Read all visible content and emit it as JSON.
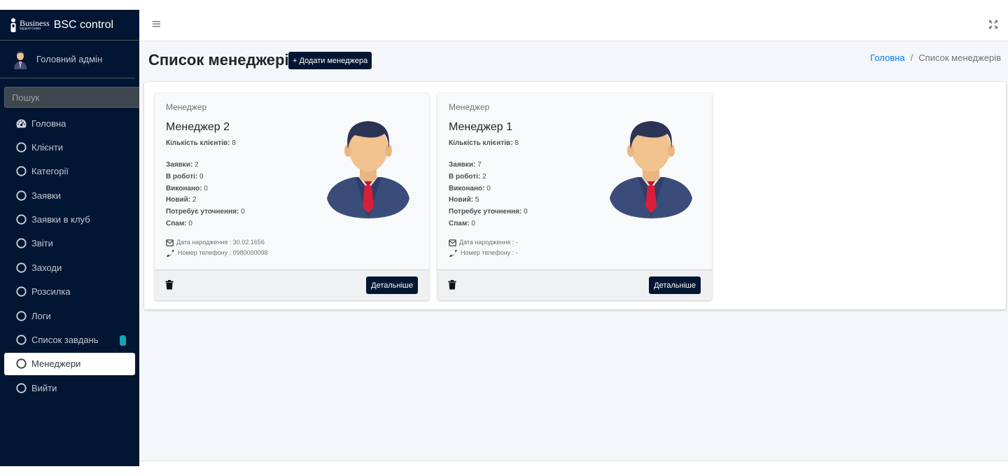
{
  "app": {
    "brand_logo_big": "Business",
    "brand_logo_small": "Support Center",
    "brand_title": "BSC control"
  },
  "user": {
    "name": "Головний адмін"
  },
  "search": {
    "placeholder": "Пошук"
  },
  "sidebar": {
    "items": [
      {
        "label": "Головна",
        "icon": "dashboard-icon"
      },
      {
        "label": "Клієнти",
        "icon": "circle-icon"
      },
      {
        "label": "Категорії",
        "icon": "circle-icon"
      },
      {
        "label": "Заявки",
        "icon": "circle-icon"
      },
      {
        "label": "Заявки в клуб",
        "icon": "circle-icon"
      },
      {
        "label": "Звіти",
        "icon": "circle-icon"
      },
      {
        "label": "Заходи",
        "icon": "circle-icon"
      },
      {
        "label": "Розсилка",
        "icon": "circle-icon"
      },
      {
        "label": "Логи",
        "icon": "circle-icon"
      },
      {
        "label": "Список завдань",
        "icon": "circle-icon"
      },
      {
        "label": "Менеджери",
        "icon": "circle-icon",
        "active": true
      },
      {
        "label": "Вийти",
        "icon": "circle-icon"
      }
    ]
  },
  "page": {
    "title": "Список менеджерів",
    "add_button": "+ Додати менеджера"
  },
  "breadcrumb": {
    "home": "Головна",
    "separator": "/",
    "current": "Список менеджерів"
  },
  "managers": [
    {
      "header": "Менеджер",
      "name": "Менеджер 2",
      "clients_label": "Кількість клієнтів:",
      "clients_value": "8",
      "requests_label": "Заявки:",
      "requests_value": "2",
      "in_work_label": "В роботі:",
      "in_work_value": "0",
      "done_label": "Виконано:",
      "done_value": "0",
      "new_label": "Новий:",
      "new_value": "2",
      "clarify_label": "Потребує уточнення:",
      "clarify_value": "0",
      "spam_label": "Спам:",
      "spam_value": "0",
      "birth": "Дата народження : 30.02.1656",
      "phone": "Номер телефону : 0980000098",
      "details_button": "Детальніше"
    },
    {
      "header": "Менеджер",
      "name": "Менеджер 1",
      "clients_label": "Кількість клієнтів:",
      "clients_value": "8",
      "requests_label": "Заявки:",
      "requests_value": "7",
      "in_work_label": "В роботі:",
      "in_work_value": "2",
      "done_label": "Виконано:",
      "done_value": "0",
      "new_label": "Новий:",
      "new_value": "5",
      "clarify_label": "Потребує уточнення:",
      "clarify_value": "0",
      "spam_label": "Спам:",
      "spam_value": "0",
      "birth": "Дата народження : -",
      "phone": "Номер телефону : -",
      "details_button": "Детальніше"
    }
  ],
  "colors": {
    "sidebar_bg": "#021633",
    "primary_button": "#021633",
    "link": "#007bff",
    "badge": "#17a2b8"
  }
}
